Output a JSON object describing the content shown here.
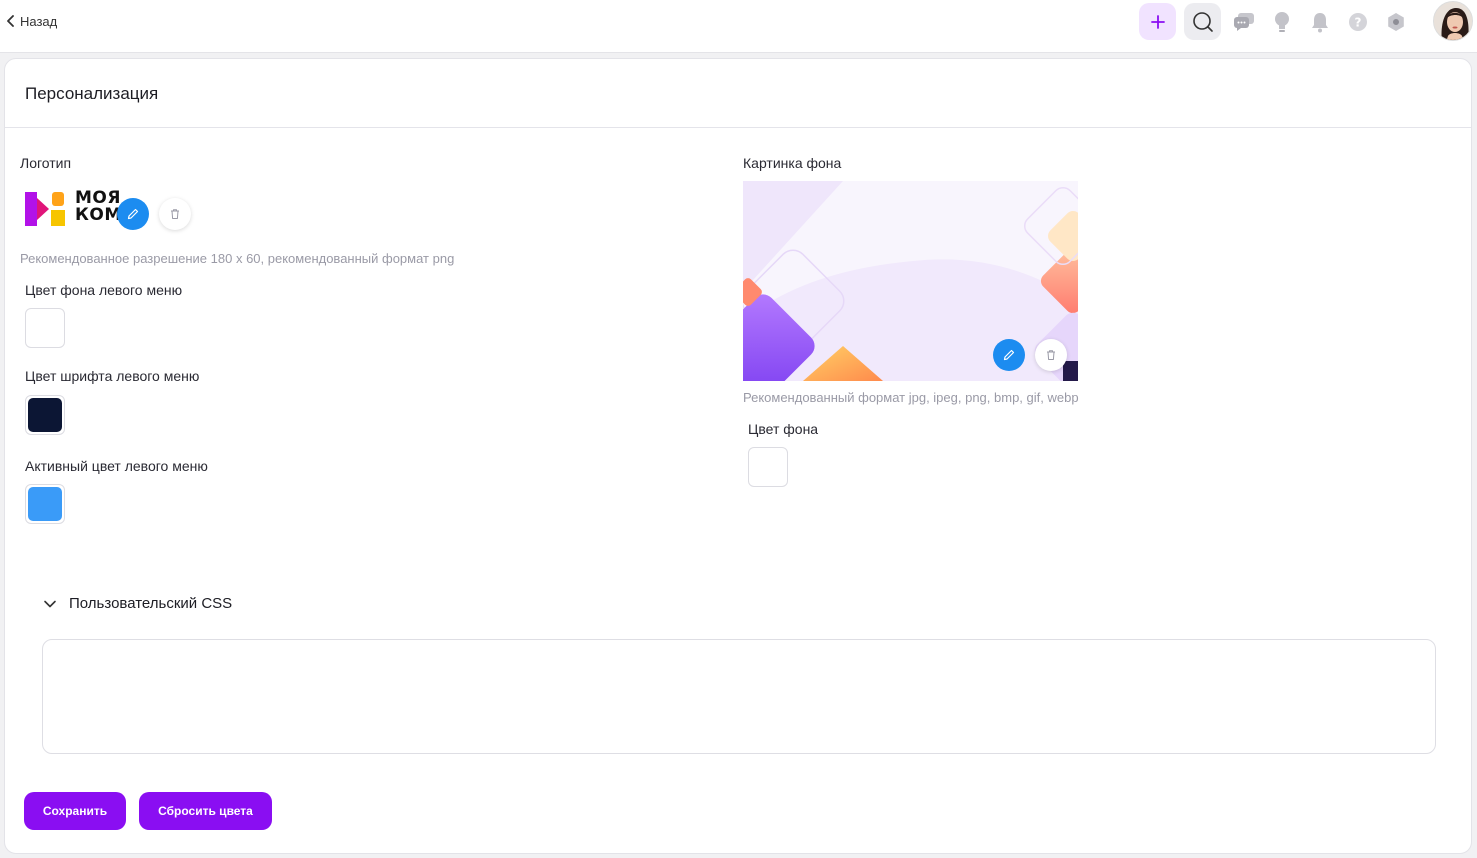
{
  "header": {
    "back_label": "Назад",
    "icons": [
      "add-icon",
      "search-icon",
      "chat-icon",
      "bulb-icon",
      "bell-icon",
      "help-icon",
      "settings-icon"
    ]
  },
  "page": {
    "title": "Персонализация"
  },
  "logo_section": {
    "label": "Логотип",
    "logo_text_line1": "МОЯ",
    "logo_text_line2": "КОМ",
    "hint": "Рекомендованное разрешение 180 х 60, рекомендованный формат png"
  },
  "left_menu": {
    "bg_color_label": "Цвет фона левого меню",
    "bg_color": "#ffffff",
    "font_color_label": "Цвет шрифта левого меню",
    "font_color": "#0c1634",
    "active_color_label": "Активный цвет левого меню",
    "active_color": "#3a9bf8"
  },
  "background_section": {
    "label": "Картинка фона",
    "hint": "Рекомендованный формат jpg, ipeg, png, bmp, gif, webp",
    "bg_color_label": "Цвет фона",
    "bg_color": "#ffffff"
  },
  "custom_css": {
    "title": "Пользовательский CSS",
    "value": ""
  },
  "actions": {
    "save_label": "Сохранить",
    "reset_label": "Сбросить цвета"
  },
  "colors": {
    "accent": "#8a0ef2",
    "edit_button": "#1c8cf0"
  }
}
